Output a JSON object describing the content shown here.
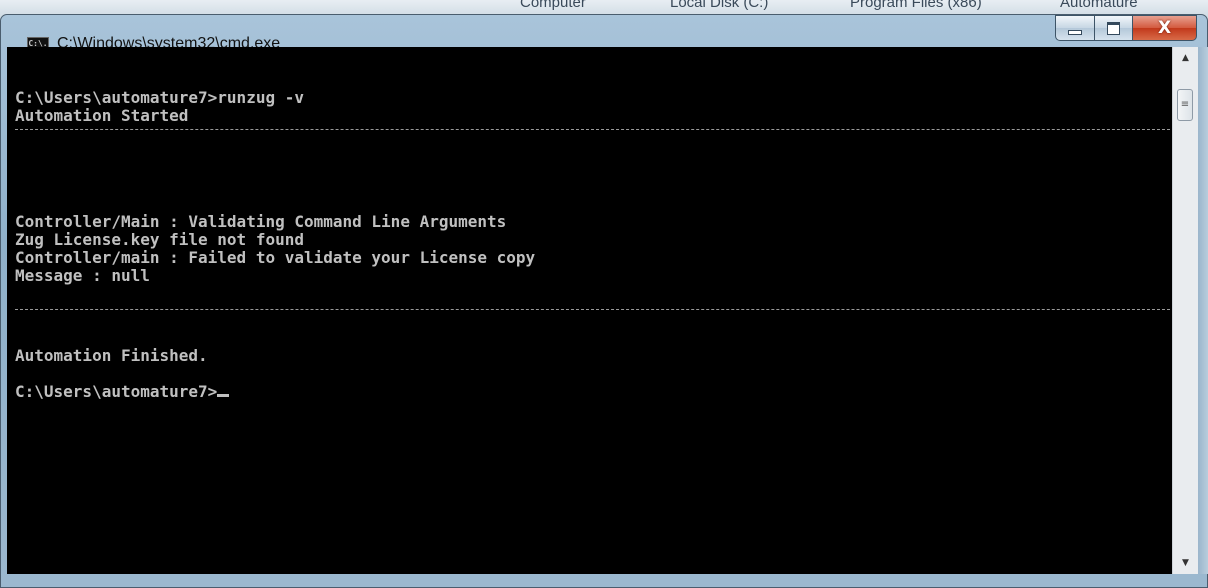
{
  "background": {
    "breadcrumb": [
      "Computer",
      "Local Disk (C:)",
      "Program Files (x86)",
      "Automature"
    ]
  },
  "window": {
    "title": "C:\\Windows\\system32\\cmd.exe",
    "icon_label": "C:\\.",
    "icon": "console-app-icon",
    "buttons": {
      "minimize": "minimize-icon",
      "maximize": "maximize-icon",
      "close": "close-icon",
      "close_glyph": "X"
    }
  },
  "console": {
    "lines": {
      "cmd1": "C:\\Users\\automature7>runzug -v",
      "started": "Automation Started",
      "validating": "Controller/Main : Validating Command Line Arguments",
      "not_found": "Zug License.key file not found",
      "failed": "Controller/main : Failed to validate your License copy",
      "message": "Message : null",
      "finished": "Automation Finished.",
      "prompt": "C:\\Users\\automature7>"
    }
  },
  "colors": {
    "console_bg": "#000000",
    "console_text": "#c0c0c0",
    "close_button": "#c2391b"
  }
}
